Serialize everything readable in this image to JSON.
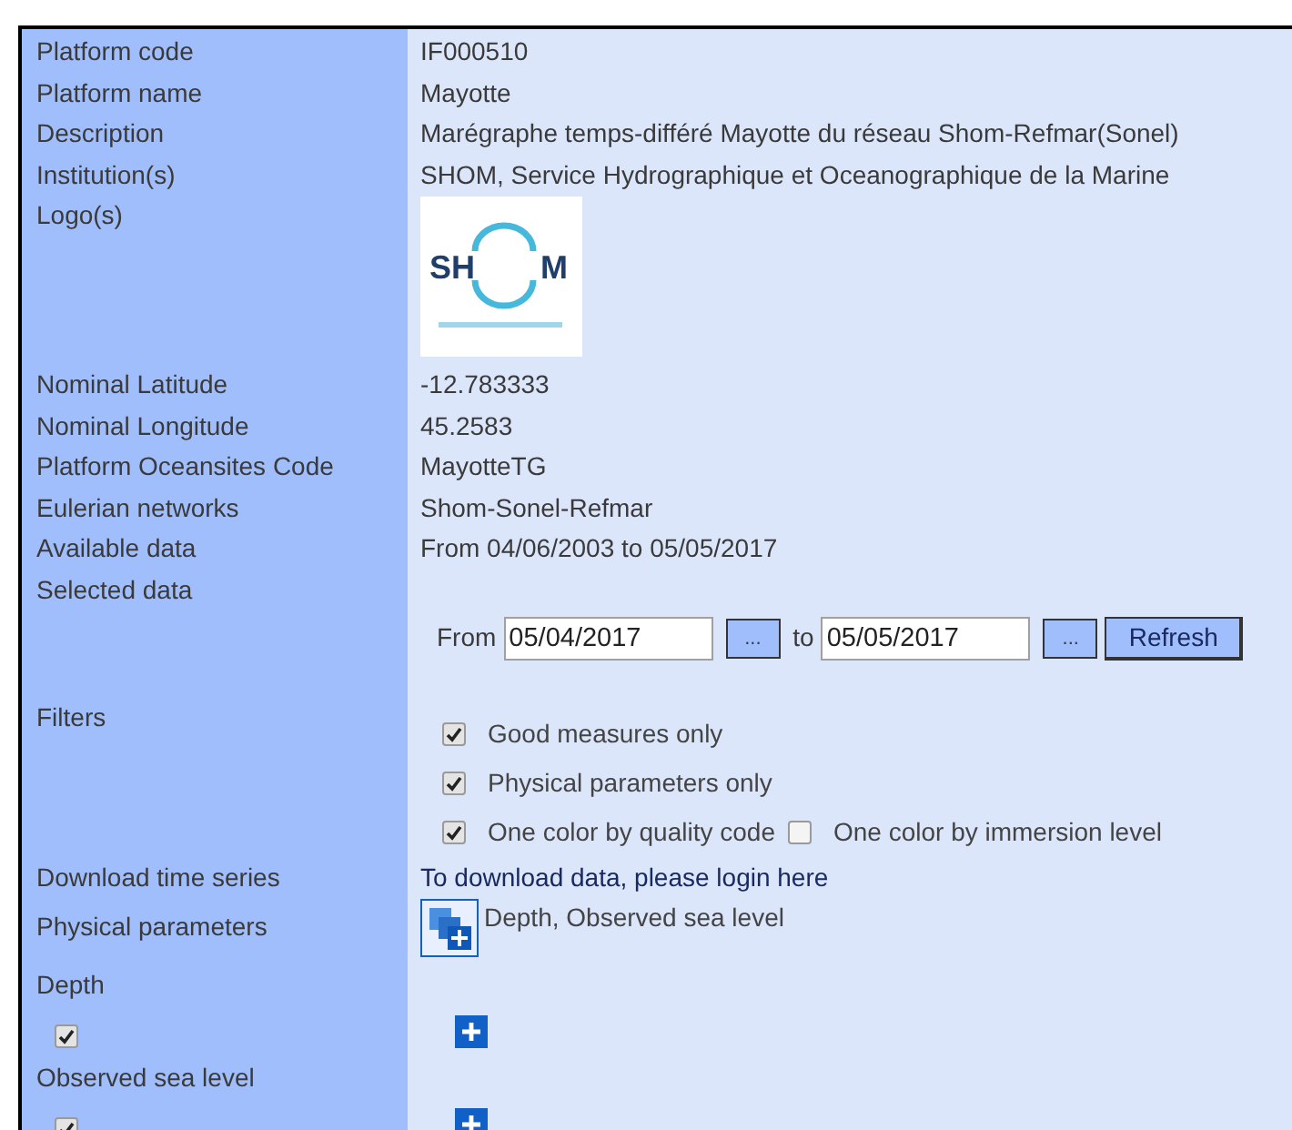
{
  "rows": [
    {
      "kind": "text",
      "label": "Platform code",
      "value": "IF000510"
    },
    {
      "kind": "text",
      "label": "Platform name",
      "value": "Mayotte"
    },
    {
      "kind": "text",
      "label": "Description",
      "value": "Marégraphe temps-différé Mayotte du réseau Shom-Refmar(Sonel)"
    },
    {
      "kind": "text",
      "label": "Institution(s)",
      "value": "SHOM, Service Hydrographique et Oceanographique de la Marine"
    },
    {
      "kind": "logo",
      "label": "Logo(s)",
      "logo_left": "SH",
      "logo_right": "M"
    },
    {
      "kind": "text",
      "label": "Nominal Latitude",
      "value": "-12.783333"
    },
    {
      "kind": "text",
      "label": "Nominal Longitude",
      "value": "45.2583"
    },
    {
      "kind": "text",
      "label": "Platform Oceansites Code",
      "value": "MayotteTG"
    },
    {
      "kind": "text",
      "label": "Eulerian networks",
      "value": "Shom-Sonel-Refmar"
    },
    {
      "kind": "text",
      "label": "Available data",
      "value": "From 04/06/2003 to 05/05/2017"
    },
    {
      "kind": "date_range",
      "label": "Selected data",
      "from_label": "From",
      "from_value": "05/04/2017",
      "picker": "...",
      "to_label": "to",
      "to_value": "05/05/2017",
      "to_picker": "...",
      "button": "Refresh"
    },
    {
      "kind": "filters",
      "label": "Filters",
      "lines": [
        [
          {
            "label": "Good measures only",
            "checked": true
          }
        ],
        [
          {
            "label": "Physical parameters only",
            "checked": true
          }
        ],
        [
          {
            "label": "One color by quality code",
            "checked": true
          },
          {
            "label": "One color by immersion level",
            "checked": false
          }
        ]
      ]
    },
    {
      "kind": "link",
      "label": "Download time series",
      "value": "To download data, please login here"
    },
    {
      "kind": "parameters",
      "label": "Physical parameters",
      "value": "Depth, Observed sea level"
    },
    {
      "kind": "param",
      "label": "Depth",
      "checked": true
    },
    {
      "kind": "param",
      "label": "Observed sea level",
      "checked": true
    }
  ]
}
